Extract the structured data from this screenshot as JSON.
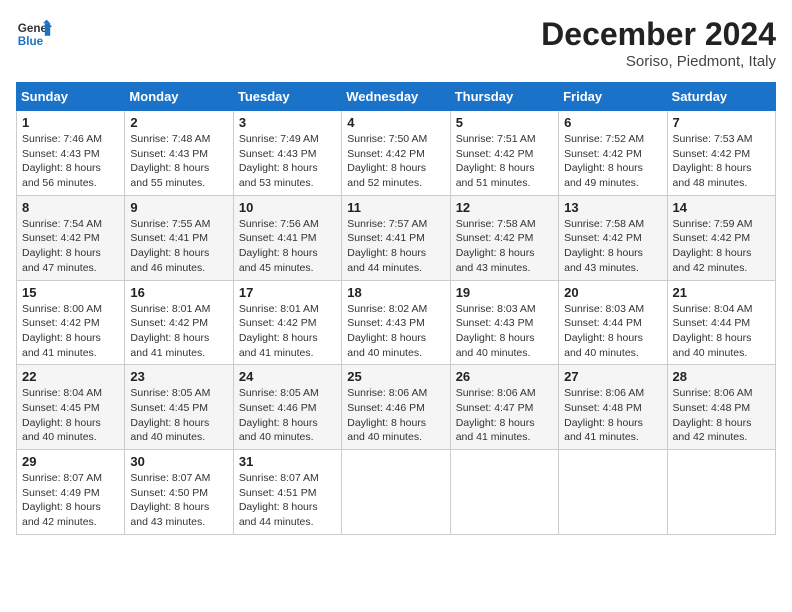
{
  "header": {
    "logo_line1": "General",
    "logo_line2": "Blue",
    "title": "December 2024",
    "subtitle": "Soriso, Piedmont, Italy"
  },
  "days_of_week": [
    "Sunday",
    "Monday",
    "Tuesday",
    "Wednesday",
    "Thursday",
    "Friday",
    "Saturday"
  ],
  "weeks": [
    [
      {
        "day": "1",
        "sunrise": "7:46 AM",
        "sunset": "4:43 PM",
        "daylight": "8 hours and 56 minutes."
      },
      {
        "day": "2",
        "sunrise": "7:48 AM",
        "sunset": "4:43 PM",
        "daylight": "8 hours and 55 minutes."
      },
      {
        "day": "3",
        "sunrise": "7:49 AM",
        "sunset": "4:43 PM",
        "daylight": "8 hours and 53 minutes."
      },
      {
        "day": "4",
        "sunrise": "7:50 AM",
        "sunset": "4:42 PM",
        "daylight": "8 hours and 52 minutes."
      },
      {
        "day": "5",
        "sunrise": "7:51 AM",
        "sunset": "4:42 PM",
        "daylight": "8 hours and 51 minutes."
      },
      {
        "day": "6",
        "sunrise": "7:52 AM",
        "sunset": "4:42 PM",
        "daylight": "8 hours and 49 minutes."
      },
      {
        "day": "7",
        "sunrise": "7:53 AM",
        "sunset": "4:42 PM",
        "daylight": "8 hours and 48 minutes."
      }
    ],
    [
      {
        "day": "8",
        "sunrise": "7:54 AM",
        "sunset": "4:42 PM",
        "daylight": "8 hours and 47 minutes."
      },
      {
        "day": "9",
        "sunrise": "7:55 AM",
        "sunset": "4:41 PM",
        "daylight": "8 hours and 46 minutes."
      },
      {
        "day": "10",
        "sunrise": "7:56 AM",
        "sunset": "4:41 PM",
        "daylight": "8 hours and 45 minutes."
      },
      {
        "day": "11",
        "sunrise": "7:57 AM",
        "sunset": "4:41 PM",
        "daylight": "8 hours and 44 minutes."
      },
      {
        "day": "12",
        "sunrise": "7:58 AM",
        "sunset": "4:42 PM",
        "daylight": "8 hours and 43 minutes."
      },
      {
        "day": "13",
        "sunrise": "7:58 AM",
        "sunset": "4:42 PM",
        "daylight": "8 hours and 43 minutes."
      },
      {
        "day": "14",
        "sunrise": "7:59 AM",
        "sunset": "4:42 PM",
        "daylight": "8 hours and 42 minutes."
      }
    ],
    [
      {
        "day": "15",
        "sunrise": "8:00 AM",
        "sunset": "4:42 PM",
        "daylight": "8 hours and 41 minutes."
      },
      {
        "day": "16",
        "sunrise": "8:01 AM",
        "sunset": "4:42 PM",
        "daylight": "8 hours and 41 minutes."
      },
      {
        "day": "17",
        "sunrise": "8:01 AM",
        "sunset": "4:42 PM",
        "daylight": "8 hours and 41 minutes."
      },
      {
        "day": "18",
        "sunrise": "8:02 AM",
        "sunset": "4:43 PM",
        "daylight": "8 hours and 40 minutes."
      },
      {
        "day": "19",
        "sunrise": "8:03 AM",
        "sunset": "4:43 PM",
        "daylight": "8 hours and 40 minutes."
      },
      {
        "day": "20",
        "sunrise": "8:03 AM",
        "sunset": "4:44 PM",
        "daylight": "8 hours and 40 minutes."
      },
      {
        "day": "21",
        "sunrise": "8:04 AM",
        "sunset": "4:44 PM",
        "daylight": "8 hours and 40 minutes."
      }
    ],
    [
      {
        "day": "22",
        "sunrise": "8:04 AM",
        "sunset": "4:45 PM",
        "daylight": "8 hours and 40 minutes."
      },
      {
        "day": "23",
        "sunrise": "8:05 AM",
        "sunset": "4:45 PM",
        "daylight": "8 hours and 40 minutes."
      },
      {
        "day": "24",
        "sunrise": "8:05 AM",
        "sunset": "4:46 PM",
        "daylight": "8 hours and 40 minutes."
      },
      {
        "day": "25",
        "sunrise": "8:06 AM",
        "sunset": "4:46 PM",
        "daylight": "8 hours and 40 minutes."
      },
      {
        "day": "26",
        "sunrise": "8:06 AM",
        "sunset": "4:47 PM",
        "daylight": "8 hours and 41 minutes."
      },
      {
        "day": "27",
        "sunrise": "8:06 AM",
        "sunset": "4:48 PM",
        "daylight": "8 hours and 41 minutes."
      },
      {
        "day": "28",
        "sunrise": "8:06 AM",
        "sunset": "4:48 PM",
        "daylight": "8 hours and 42 minutes."
      }
    ],
    [
      {
        "day": "29",
        "sunrise": "8:07 AM",
        "sunset": "4:49 PM",
        "daylight": "8 hours and 42 minutes."
      },
      {
        "day": "30",
        "sunrise": "8:07 AM",
        "sunset": "4:50 PM",
        "daylight": "8 hours and 43 minutes."
      },
      {
        "day": "31",
        "sunrise": "8:07 AM",
        "sunset": "4:51 PM",
        "daylight": "8 hours and 44 minutes."
      },
      null,
      null,
      null,
      null
    ]
  ]
}
